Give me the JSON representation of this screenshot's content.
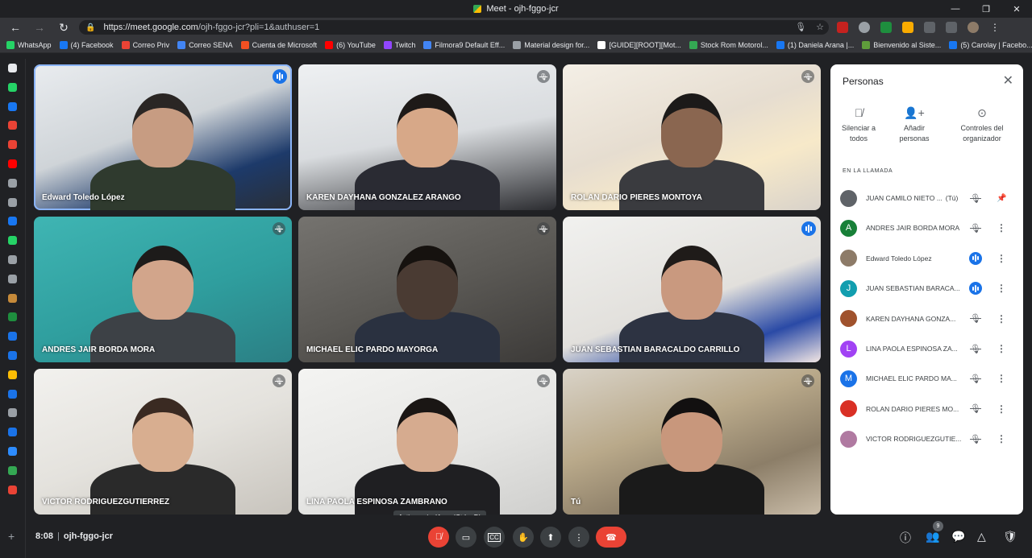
{
  "window": {
    "title": "Meet - ojh-fggo-jcr"
  },
  "browser": {
    "url_host": "https://meet.google.com",
    "url_path": "/ojh-fggo-jcr?pli=1&authuser=1"
  },
  "bookmarks": [
    {
      "label": "WhatsApp",
      "color": "#25d366"
    },
    {
      "label": "(4) Facebook",
      "color": "#1877f2"
    },
    {
      "label": "Correo Priv",
      "color": "#ea4335"
    },
    {
      "label": "Correo SENA",
      "color": "#4285f4"
    },
    {
      "label": "Cuenta de Microsoft",
      "color": "#f25022"
    },
    {
      "label": "(6) YouTube",
      "color": "#ff0000"
    },
    {
      "label": "Twitch",
      "color": "#9146ff"
    },
    {
      "label": "Filmora9 Default Eff...",
      "color": "#4285f4"
    },
    {
      "label": "Material design for...",
      "color": "#9aa0a6"
    },
    {
      "label": "[GUIDE][ROOT][Mot...",
      "color": "#ffffff"
    },
    {
      "label": "Stock Rom Motorol...",
      "color": "#34a853"
    },
    {
      "label": "(1) Daniela Arana |...",
      "color": "#1877f2"
    },
    {
      "label": "Bienvenido al Siste...",
      "color": "#5f9e3b"
    },
    {
      "label": "(5) Carolay | Facebo...",
      "color": "#1877f2"
    }
  ],
  "tiles": [
    {
      "name": "Edward Toledo López",
      "state": "speaking"
    },
    {
      "name": "KAREN DAYHANA GONZALEZ ARANGO",
      "state": "muted"
    },
    {
      "name": "ROLAN DARIO PIERES MONTOYA",
      "state": "muted"
    },
    {
      "name": "ANDRES JAIR BORDA MORA",
      "state": "muted"
    },
    {
      "name": "MICHAEL ELIC PARDO MAYORGA",
      "state": "muted"
    },
    {
      "name": "JUAN SEBASTIAN BARACALDO CARRILLO",
      "state": "speaking"
    },
    {
      "name": "VICTOR RODRIGUEZGUTIERREZ",
      "state": "muted"
    },
    {
      "name": "LINA PAOLA ESPINOSA ZAMBRANO",
      "state": "muted"
    },
    {
      "name": "Tú",
      "state": "muted"
    }
  ],
  "panel": {
    "title": "Personas",
    "actions": [
      {
        "line1": "Silenciar a",
        "line2": "todos"
      },
      {
        "line1": "Añadir",
        "line2": "personas"
      },
      {
        "line1": "Controles del",
        "line2": "organizador"
      }
    ],
    "section_label": "EN LA LLAMADA",
    "participants": [
      {
        "name": "JUAN CAMILO NIETO ...",
        "suffix": "(Tú)",
        "initial": "",
        "color": "#5f6368",
        "mic": "muted",
        "action": "pin"
      },
      {
        "name": "ANDRES JAIR BORDA MORA",
        "initial": "A",
        "color": "#188038",
        "mic": "muted",
        "action": "more"
      },
      {
        "name": "Edward Toledo López",
        "initial": "",
        "color": "#8d7b68",
        "mic": "speaking",
        "action": "more"
      },
      {
        "name": "JUAN SEBASTIAN BARACA...",
        "initial": "J",
        "color": "#129eaf",
        "mic": "speaking",
        "action": "more"
      },
      {
        "name": "KAREN DAYHANA GONZA...",
        "initial": "",
        "color": "#a0522d",
        "mic": "muted",
        "action": "more"
      },
      {
        "name": "LINA PAOLA ESPINOSA ZA...",
        "initial": "L",
        "color": "#a142f4",
        "mic": "muted",
        "action": "more"
      },
      {
        "name": "MICHAEL ELIC PARDO MA...",
        "initial": "M",
        "color": "#1a73e8",
        "mic": "muted",
        "action": "more"
      },
      {
        "name": "ROLAN DARIO PIERES MO...",
        "initial": "",
        "color": "#d93025",
        "mic": "muted",
        "action": "more"
      },
      {
        "name": "VICTOR RODRIGUEZGUTIE...",
        "initial": "",
        "color": "#b07aa1",
        "mic": "muted",
        "action": "more"
      }
    ]
  },
  "bottom": {
    "time": "8:08",
    "separator": "|",
    "meeting_code": "ojh-fggo-jcr",
    "tooltip": "Activar micrófono (Ctrl + D)",
    "people_count": "9"
  }
}
